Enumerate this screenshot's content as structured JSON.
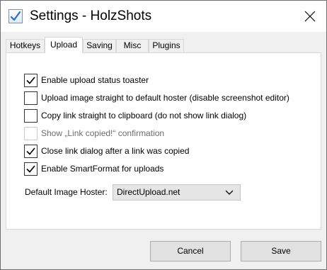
{
  "window": {
    "title": "Settings - HolzShots",
    "app_icon": "checkmark-app-icon",
    "close_icon": "close-icon"
  },
  "tabs": [
    {
      "label": "Hotkeys",
      "active": false
    },
    {
      "label": "Upload",
      "active": true
    },
    {
      "label": "Saving",
      "active": false
    },
    {
      "label": "Misc",
      "active": false
    },
    {
      "label": "Plugins",
      "active": false
    }
  ],
  "upload": {
    "options": [
      {
        "label": "Enable upload status toaster",
        "checked": true,
        "enabled": true
      },
      {
        "label": "Upload image straight to default hoster (disable screenshot editor)",
        "checked": false,
        "enabled": true
      },
      {
        "label": "Copy link straight to clipboard (do not show link dialog)",
        "checked": false,
        "enabled": true
      },
      {
        "label": "Show „Link copied!“ confirmation",
        "checked": false,
        "enabled": false
      },
      {
        "label": "Close link dialog after a link was copied",
        "checked": true,
        "enabled": true
      },
      {
        "label": "Enable SmartFormat for uploads",
        "checked": true,
        "enabled": true
      }
    ],
    "default_hoster_label": "Default Image Hoster:",
    "default_hoster_value": "DirectUpload.net",
    "dropdown_icon": "chevron-down-icon"
  },
  "buttons": {
    "cancel": "Cancel",
    "save": "Save"
  },
  "colors": {
    "window_bg": "#f0f0f0",
    "panel_bg": "#ffffff",
    "button_bg": "#e1e1e1",
    "disabled_text": "#6d6d6d"
  }
}
